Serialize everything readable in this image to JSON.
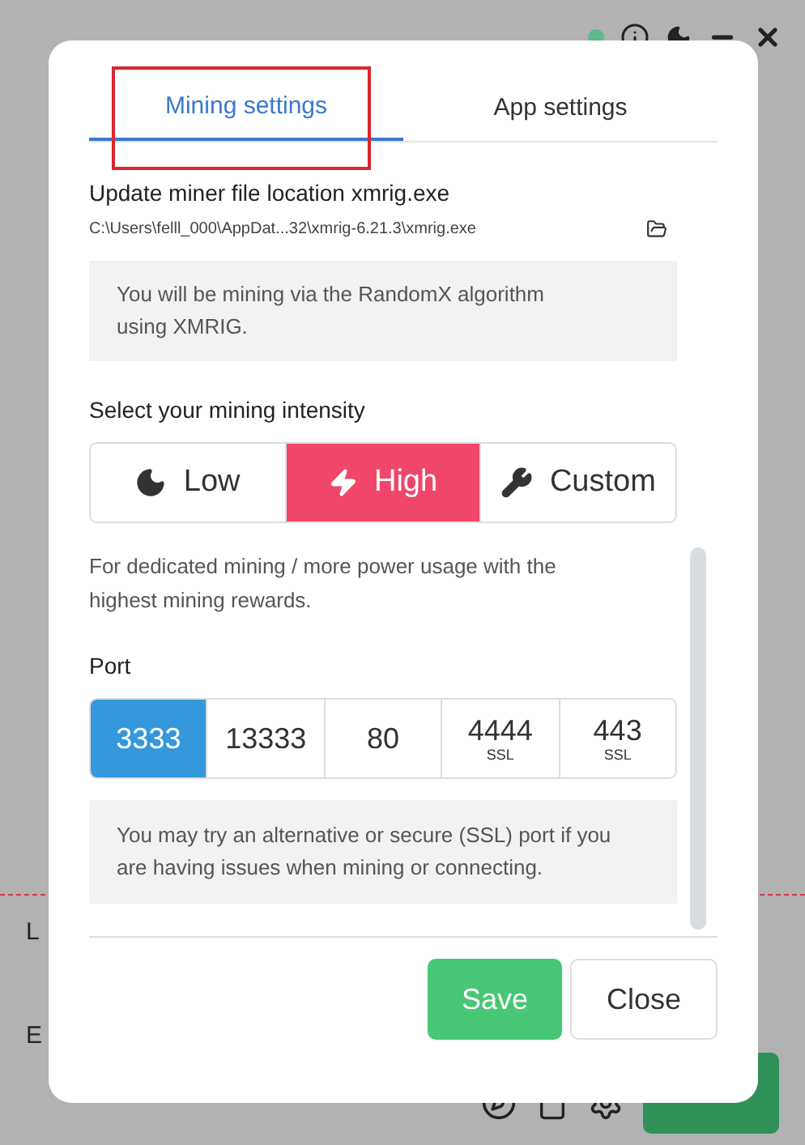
{
  "stats": [
    {
      "label": "L"
    },
    {
      "label": "E"
    }
  ],
  "modal": {
    "tabs": [
      {
        "label": "Mining settings",
        "selected": true,
        "highlighted": true
      },
      {
        "label": "App settings",
        "selected": false,
        "highlighted": false
      }
    ],
    "miner_file": {
      "heading": "Update miner file location xmrig.exe",
      "path": "C:\\Users\\felll_000\\AppDat...32\\xmrig-6.21.3\\xmrig.exe"
    },
    "algorithm_note": "You will be mining via the RandomX algorithm using XMRIG.",
    "intensity": {
      "label": "Select your mining intensity",
      "options": [
        {
          "label": "Low",
          "selected": false
        },
        {
          "label": "High",
          "selected": true
        },
        {
          "label": "Custom",
          "selected": false
        }
      ],
      "description": "For dedicated mining / more power usage with the highest mining rewards."
    },
    "port": {
      "label": "Port",
      "options": [
        {
          "value": "3333",
          "selected": true
        },
        {
          "value": "13333",
          "selected": false
        },
        {
          "value": "80",
          "selected": false
        },
        {
          "value": "4444",
          "tag": "SSL",
          "selected": false
        },
        {
          "value": "443",
          "tag": "SSL",
          "selected": false
        }
      ],
      "note": "You may try an alternative or secure (SSL) port if you are having issues when mining or connecting."
    },
    "buttons": [
      {
        "label": "Save",
        "kind": "primary"
      },
      {
        "label": "Close",
        "kind": "secondary"
      }
    ]
  }
}
